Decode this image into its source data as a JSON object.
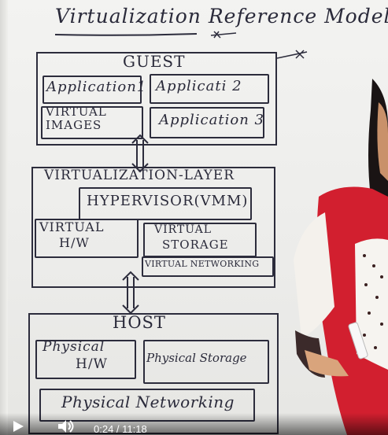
{
  "whiteboard": {
    "title": "Virtualization Reference Model:-",
    "guest": {
      "label": "GUEST",
      "app1": "Application1",
      "app2": "Applicati 2",
      "virtual_images": "VIRTUAL IMAGES",
      "app3": "Application 3"
    },
    "virtualization_layer": {
      "label": "VIRTUALIZATION-LAYER",
      "hypervisor": "HYPERVISOR(VMM)",
      "virtual_hw_line1": "VIRTUAL",
      "virtual_hw_line2": "H/W",
      "virtual_storage_line1": "VIRTUAL",
      "virtual_storage_line2": "STORAGE",
      "virtual_networking": "VIRTUAL NETWORKING"
    },
    "host": {
      "label": "HOST",
      "physical_hw_line1": "Physical",
      "physical_hw_line2": "H/W",
      "physical_storage": "Physical Storage",
      "physical_networking": "Physical Networking"
    }
  },
  "player": {
    "time_display": "0:24 / 11:18",
    "play_icon": "play-icon",
    "volume_icon": "volume-icon"
  },
  "colors": {
    "ink": "#2a2a3a",
    "board": "#f0f0ee",
    "saree": "#d21f2f",
    "skin": "#d9a47c"
  }
}
